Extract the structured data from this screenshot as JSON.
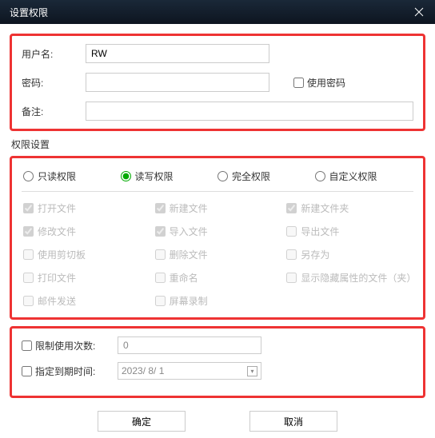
{
  "title": "设置权限",
  "basic": {
    "username_label": "用户名:",
    "username_value": "RW",
    "password_label": "密码:",
    "password_value": "",
    "use_password_label": "使用密码",
    "remark_label": "备注:",
    "remark_value": ""
  },
  "perm": {
    "section_title": "权限设置",
    "radios": [
      {
        "label": "只读权限",
        "checked": false
      },
      {
        "label": "读写权限",
        "checked": true
      },
      {
        "label": "完全权限",
        "checked": false
      },
      {
        "label": "自定义权限",
        "checked": false
      }
    ],
    "items": [
      {
        "label": "打开文件",
        "checked": true
      },
      {
        "label": "新建文件",
        "checked": true
      },
      {
        "label": "新建文件夹",
        "checked": true
      },
      {
        "label": "修改文件",
        "checked": true
      },
      {
        "label": "导入文件",
        "checked": true
      },
      {
        "label": "导出文件",
        "checked": false
      },
      {
        "label": "使用剪切板",
        "checked": false
      },
      {
        "label": "删除文件",
        "checked": false
      },
      {
        "label": "另存为",
        "checked": false
      },
      {
        "label": "打印文件",
        "checked": false
      },
      {
        "label": "重命名",
        "checked": false
      },
      {
        "label": "显示隐藏属性的文件（夹）",
        "checked": false
      },
      {
        "label": "邮件发送",
        "checked": false
      },
      {
        "label": "屏幕录制",
        "checked": false
      }
    ]
  },
  "limits": {
    "use_count_label": "限制使用次数:",
    "use_count_value": "0",
    "expiry_label": "指定到期时间:",
    "expiry_value": "2023/ 8/ 1"
  },
  "buttons": {
    "ok": "确定",
    "cancel": "取消"
  }
}
